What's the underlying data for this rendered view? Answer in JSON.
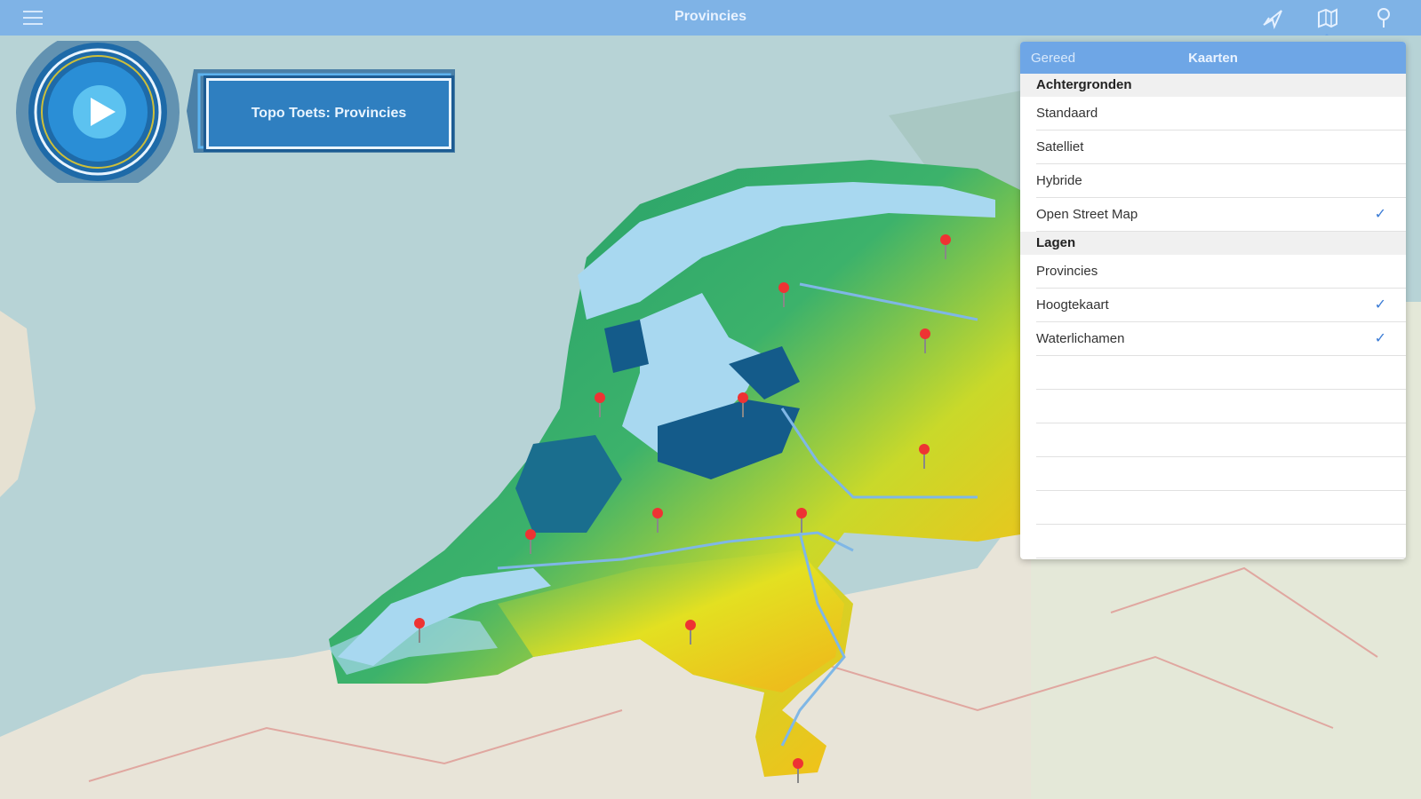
{
  "app": {
    "title": "Provincies"
  },
  "game": {
    "badge_label": "Topo Toets:  Provincies"
  },
  "panel": {
    "done_label": "Gereed",
    "title": "Kaarten",
    "sections": [
      {
        "header": "Achtergronden",
        "items": [
          {
            "label": "Standaard",
            "checked": false
          },
          {
            "label": "Satelliet",
            "checked": false
          },
          {
            "label": "Hybride",
            "checked": false
          },
          {
            "label": "Open Street Map",
            "checked": true
          }
        ]
      },
      {
        "header": "Lagen",
        "items": [
          {
            "label": "Provincies",
            "checked": false
          },
          {
            "label": "Hoogtekaart",
            "checked": true
          },
          {
            "label": "Waterlichamen",
            "checked": true
          }
        ]
      }
    ],
    "check_glyph": "✓"
  },
  "colors": {
    "topbar": "#7fb3e6",
    "sea": "#b7d3d6",
    "accent": "#3a7bd5"
  },
  "icons": [
    "menu-icon",
    "location-arrow-icon",
    "map-layers-icon",
    "pin-icon",
    "play-icon",
    "map-pin-icon"
  ]
}
